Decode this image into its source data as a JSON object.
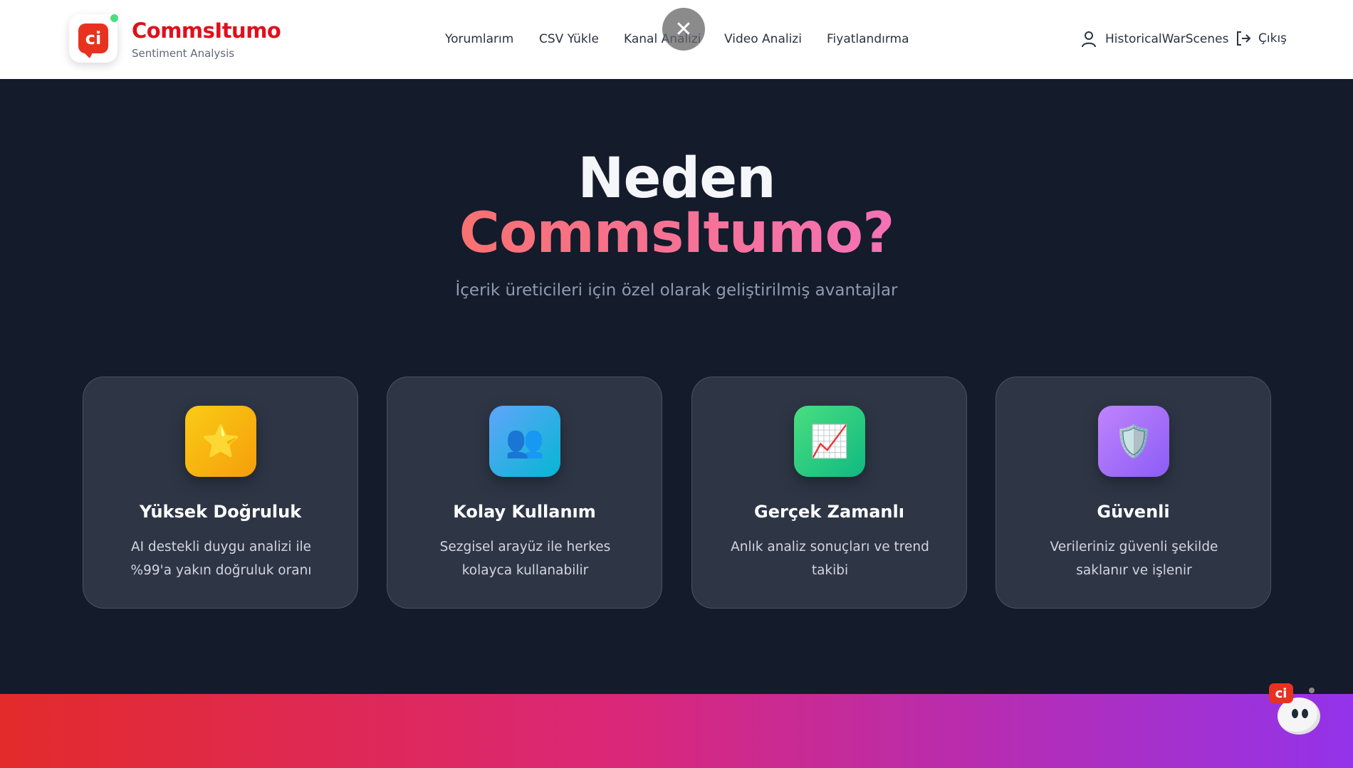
{
  "header": {
    "brand_name": "CommsItumo",
    "brand_sub": "Sentiment Analysis",
    "logo_text": "ci",
    "nav": [
      {
        "label": "Yorumlarım"
      },
      {
        "label": "CSV Yükle"
      },
      {
        "label": "Kanal Analizi"
      },
      {
        "label": "Video Analizi"
      },
      {
        "label": "Fiyatlandırma"
      }
    ],
    "user_name": "HistoricalWarScenes",
    "logout_label": "Çıkış",
    "close_symbol": "✕"
  },
  "hero": {
    "title_line1": "Neden",
    "title_line2": "CommsItumo?",
    "subtitle": "İçerik üreticileri için özel olarak geliştirilmiş avantajlar"
  },
  "features": [
    {
      "icon": "star-icon",
      "glyph": "⭐",
      "title": "Yüksek Doğruluk",
      "desc": "AI destekli duygu analizi ile %99'a yakın doğruluk oranı",
      "color_from": "#facc15",
      "color_to": "#f59e0b"
    },
    {
      "icon": "users-icon",
      "glyph": "👥",
      "title": "Kolay Kullanım",
      "desc": "Sezgisel arayüz ile herkes kolayca kullanabilir",
      "color_from": "#60a5fa",
      "color_to": "#06b6d4"
    },
    {
      "icon": "chart-icon",
      "glyph": "📈",
      "title": "Gerçek Zamanlı",
      "desc": "Anlık analiz sonuçları ve trend takibi",
      "color_from": "#4ade80",
      "color_to": "#10b981"
    },
    {
      "icon": "shield-icon",
      "glyph": "🛡️",
      "title": "Güvenli",
      "desc": "Verileriniz güvenli şekilde saklanır ve işlenir",
      "color_from": "#c084fc",
      "color_to": "#8b5cf6"
    }
  ],
  "mascot": {
    "badge_text": "ci"
  },
  "colors": {
    "brand_red": "#e0101c",
    "hero_bg": "#141b2b",
    "gradient_start": "#e32b2b",
    "gradient_mid": "#db2777",
    "gradient_end": "#9333ea"
  }
}
